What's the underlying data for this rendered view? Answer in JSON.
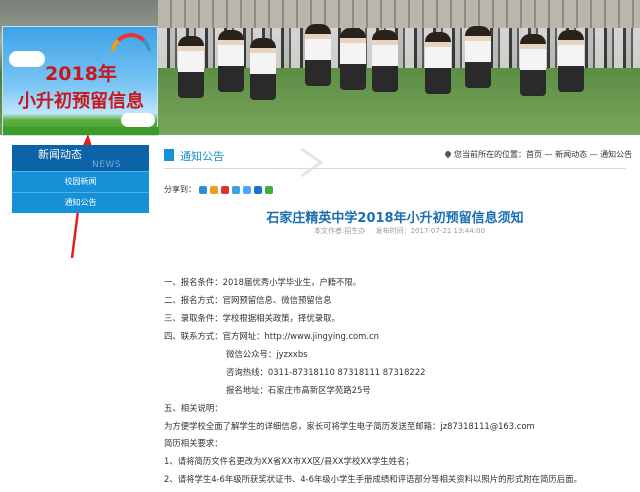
{
  "promo": {
    "line1": "2018年",
    "line2": "小升初预留信息"
  },
  "sidebar": {
    "heading": "新闻动态",
    "heading_en": "NEWS",
    "items": [
      {
        "label": "校园新闻"
      },
      {
        "label": "通知公告"
      }
    ]
  },
  "section": {
    "title": "通知公告"
  },
  "breadcrumb": {
    "text": "您当前所在的位置：首页 — 新闻动态 — 通知公告"
  },
  "share": {
    "label": "分享到："
  },
  "article": {
    "title": "石家庄精英中学2018年小升初预留信息须知",
    "author": "本文作者:招生办",
    "published": "发布时间：2017-07-21 13:44:00",
    "lines": [
      "一、报名条件：2018届优秀小学毕业生，户籍不限。",
      "二、报名方式：官网预留信息、微信预留信息",
      "三、录取条件：学校根据相关政策，择优录取。",
      "四、联系方式：官方网址：http://www.jingying.com.cn",
      "微信公众号：jyzxxbs",
      "咨询热线：0311-87318110   87318111   87318222",
      "报名地址：石家庄市高新区学苑路25号",
      "五、相关说明：",
      "为方便学校全面了解学生的详细信息，家长可将学生电子简历发送至邮箱：jz87318111@163.com",
      "简历相关要求：",
      "1、请将简历文件名更改为XX省XX市XX区/县XX学校XX学生姓名；",
      "2、请将学生4-6年级所获奖状证书、4-6年级小学生手册成绩和评语部分等相关资料以照片的形式附在简历后面。"
    ]
  },
  "colors": {
    "accent": "#1591d7",
    "sidebar_head": "#0d63a7",
    "title": "#1a6fb2",
    "promo_text": "#c8181d",
    "arrow": "#e02020"
  }
}
